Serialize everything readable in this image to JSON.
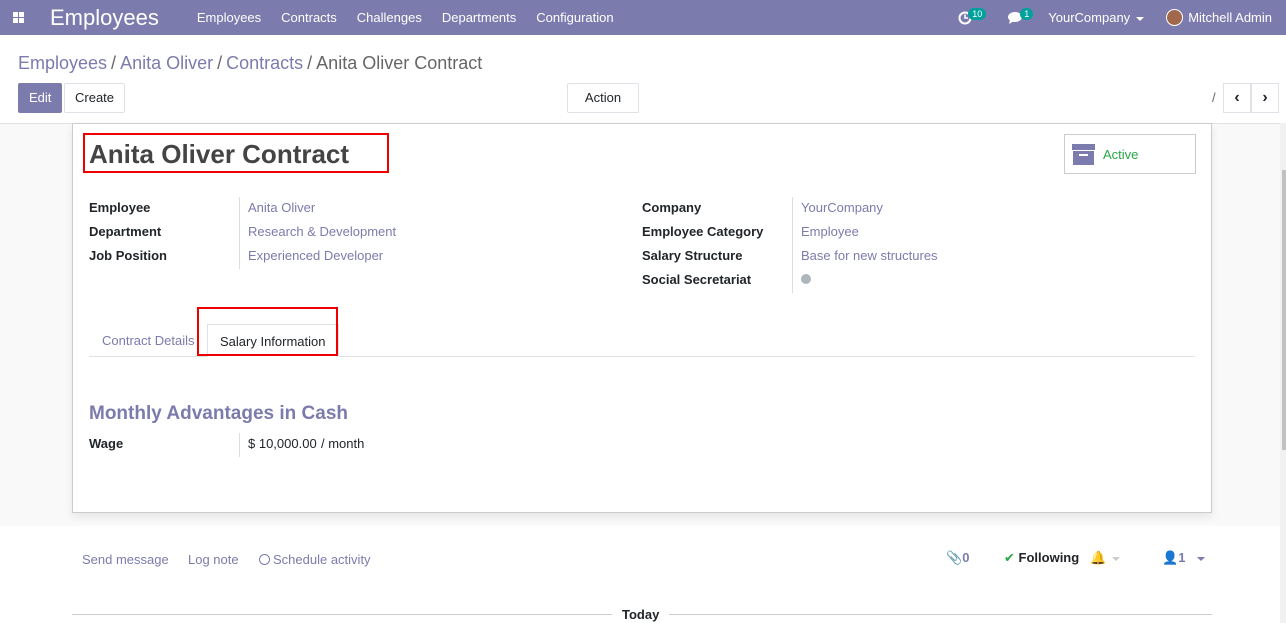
{
  "navbar": {
    "app_name": "Employees",
    "menu": [
      "Employees",
      "Contracts",
      "Challenges",
      "Departments",
      "Configuration"
    ],
    "activity_count": "10",
    "message_count": "1",
    "company": "YourCompany",
    "user": "Mitchell Admin"
  },
  "breadcrumb": [
    "Employees",
    "Anita Oliver",
    "Contracts",
    "Anita Oliver Contract"
  ],
  "control": {
    "edit_label": "Edit",
    "create_label": "Create",
    "action_label": "Action",
    "pager_separator": "/"
  },
  "record": {
    "title": "Anita Oliver Contract",
    "status": "Active",
    "left_fields": [
      {
        "label": "Employee",
        "value": "Anita Oliver"
      },
      {
        "label": "Department",
        "value": "Research & Development"
      },
      {
        "label": "Job Position",
        "value": "Experienced Developer"
      }
    ],
    "right_fields": [
      {
        "label": "Company",
        "value": "YourCompany"
      },
      {
        "label": "Employee Category",
        "value": "Employee"
      },
      {
        "label": "Salary Structure",
        "value": "Base for new structures"
      },
      {
        "label": "Social Secretariat",
        "value": ""
      }
    ],
    "tabs": [
      "Contract Details",
      "Salary Information"
    ],
    "active_tab": "Salary Information",
    "section_title": "Monthly Advantages in Cash",
    "wage_label": "Wage",
    "wage_value": "$ 10,000.00",
    "wage_unit": "/ month"
  },
  "chatter": {
    "send_message": "Send message",
    "log_note": "Log note",
    "schedule_activity": "Schedule activity",
    "attachments_count": "0",
    "following_label": "Following",
    "followers_count": "1",
    "today_label": "Today"
  },
  "colors": {
    "brand": "#7c7bad",
    "active_status": "#28a745",
    "highlight_border": "#ee0000"
  }
}
